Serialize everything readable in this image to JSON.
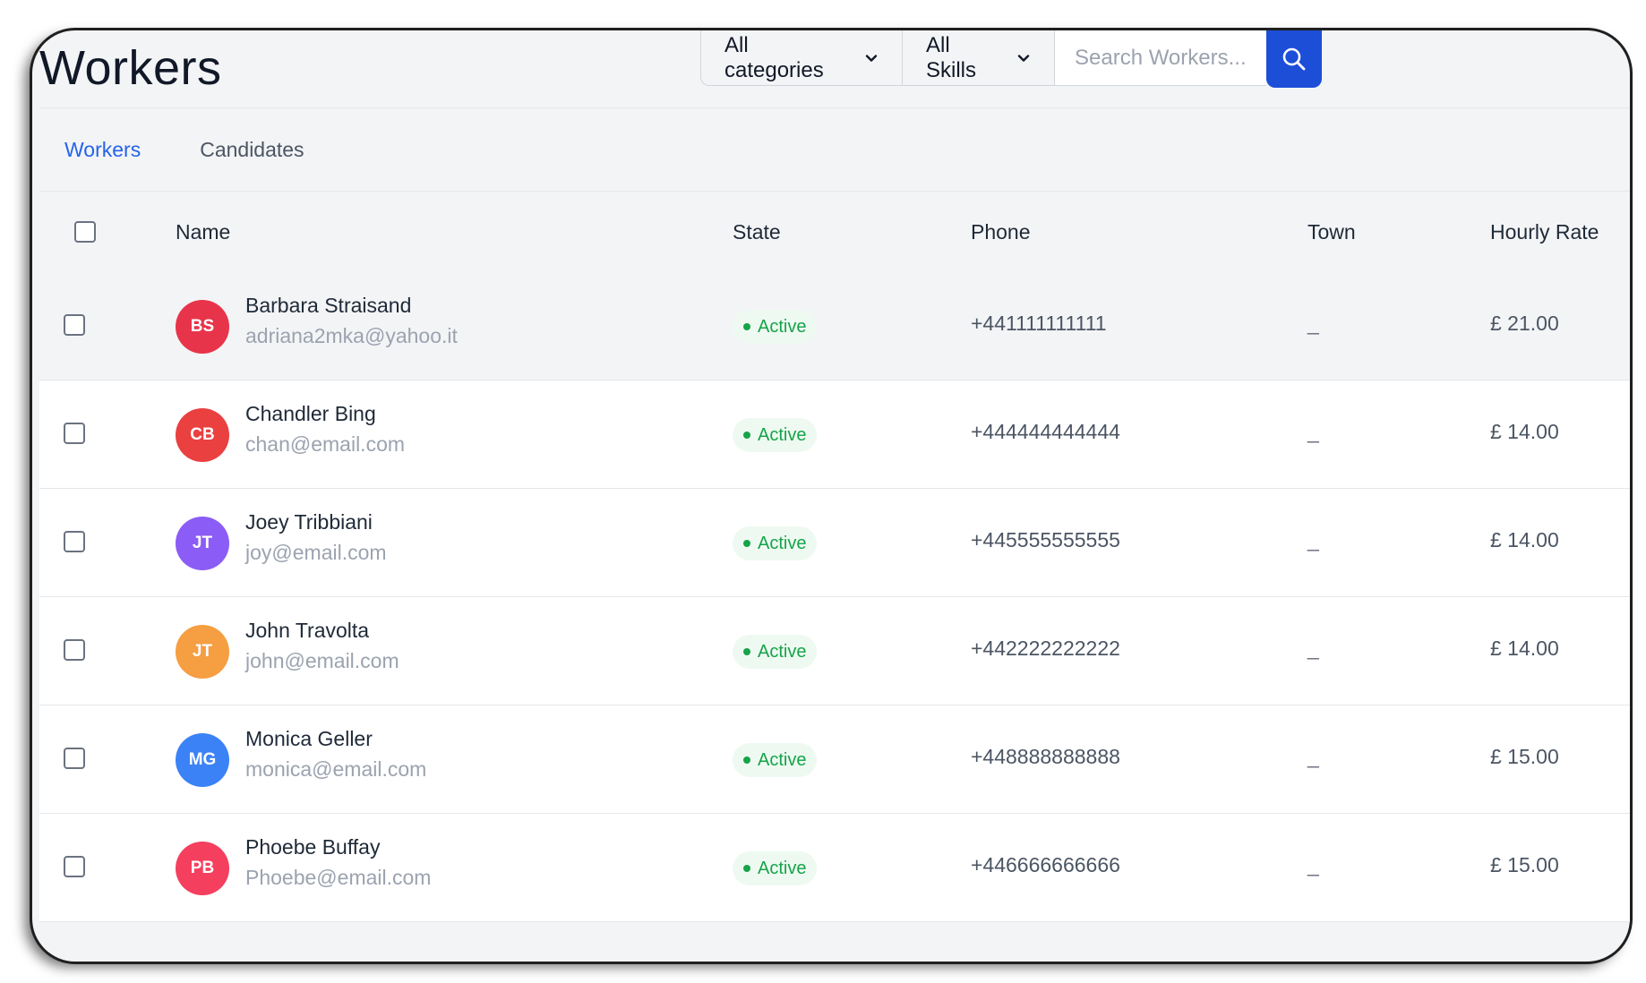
{
  "page": {
    "title": "Workers"
  },
  "filters": {
    "category": "All categories",
    "skills": "All Skills",
    "search_placeholder": "Search Workers..."
  },
  "tabs": [
    {
      "label": "Workers",
      "active": true
    },
    {
      "label": "Candidates",
      "active": false
    }
  ],
  "table": {
    "columns": [
      "Name",
      "State",
      "Phone",
      "Town",
      "Hourly Rate"
    ],
    "rows": [
      {
        "initials": "BS",
        "avatar_color": "#e8344a",
        "name": "Barbara Straisand",
        "email": "adriana2mka@yahoo.it",
        "state": "Active",
        "phone": "+441111111111",
        "town": "_",
        "rate": "£ 21.00"
      },
      {
        "initials": "CB",
        "avatar_color": "#ea4040",
        "name": "Chandler Bing",
        "email": "chan@email.com",
        "state": "Active",
        "phone": "+444444444444",
        "town": "_",
        "rate": "£ 14.00"
      },
      {
        "initials": "JT",
        "avatar_color": "#8b5cf6",
        "name": "Joey Tribbiani",
        "email": "joy@email.com",
        "state": "Active",
        "phone": "+445555555555",
        "town": "_",
        "rate": "£ 14.00"
      },
      {
        "initials": "JT",
        "avatar_color": "#f59e42",
        "name": "John Travolta",
        "email": "john@email.com",
        "state": "Active",
        "phone": "+442222222222",
        "town": "_",
        "rate": "£ 14.00"
      },
      {
        "initials": "MG",
        "avatar_color": "#3b82f6",
        "name": "Monica Geller",
        "email": "monica@email.com",
        "state": "Active",
        "phone": "+448888888888",
        "town": "_",
        "rate": "£ 15.00"
      },
      {
        "initials": "PB",
        "avatar_color": "#f43f5e",
        "name": "Phoebe Buffay",
        "email": "Phoebe@email.com",
        "state": "Active",
        "phone": "+446666666666",
        "town": "_",
        "rate": "£ 15.00"
      }
    ]
  },
  "colors": {
    "accent": "#1d4ed8",
    "active_tab": "#2563eb",
    "status_green": "#16a34a"
  },
  "icons": {
    "search": "search-icon",
    "dropdown": "chevron-down-icon"
  }
}
